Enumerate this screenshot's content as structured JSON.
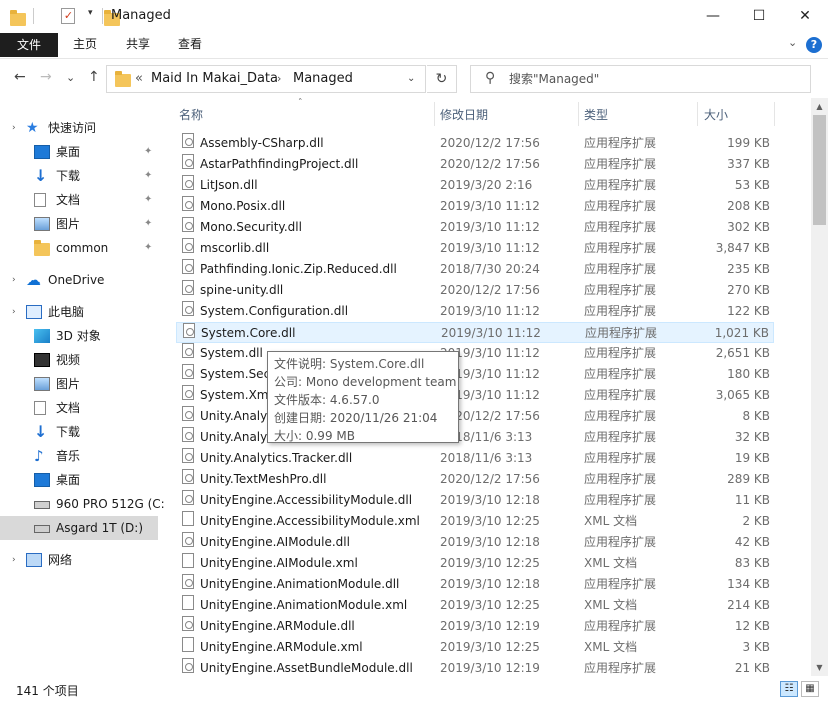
{
  "titlebar": {
    "title": "Managed",
    "dropdown_glyph": "▾",
    "minimize_glyph": "—",
    "maximize_glyph": "☐",
    "close_glyph": "✕"
  },
  "ribbon": {
    "tabs": [
      "文件",
      "主页",
      "共享",
      "查看"
    ],
    "expand_glyph": "⌄",
    "help_glyph": "?"
  },
  "address": {
    "back_glyph": "←",
    "forward_glyph": "→",
    "recent_glyph": "⌄",
    "up_glyph": "↑",
    "overflow": "«",
    "crumbs": [
      "Maid In Makai_Data",
      "Managed"
    ],
    "separator": "›",
    "dropdown_glyph": "⌄",
    "refresh_glyph": "↻",
    "search_glyph": "⚲",
    "search_placeholder": "搜索\"Managed\""
  },
  "sidebar": {
    "items": [
      {
        "label": "快速访问",
        "icon": "star-icon"
      },
      {
        "label": "桌面",
        "icon": "desktop-icon",
        "pinned": true
      },
      {
        "label": "下载",
        "icon": "download-icon",
        "pinned": true
      },
      {
        "label": "文档",
        "icon": "document-icon",
        "pinned": true
      },
      {
        "label": "图片",
        "icon": "pictures-icon",
        "pinned": true
      },
      {
        "label": "common",
        "icon": "folder-icon",
        "pinned": true
      },
      {
        "label": "OneDrive",
        "icon": "cloud-icon"
      },
      {
        "label": "此电脑",
        "icon": "pc-icon"
      },
      {
        "label": "3D 对象",
        "icon": "cube-icon"
      },
      {
        "label": "视频",
        "icon": "video-icon"
      },
      {
        "label": "图片",
        "icon": "pictures-icon"
      },
      {
        "label": "文档",
        "icon": "document-icon"
      },
      {
        "label": "下载",
        "icon": "download-icon"
      },
      {
        "label": "音乐",
        "icon": "music-icon"
      },
      {
        "label": "桌面",
        "icon": "desktop-icon"
      },
      {
        "label": "960 PRO 512G (C:",
        "icon": "drive-icon"
      },
      {
        "label": "Asgard 1T (D:)",
        "icon": "drive-icon",
        "selected": true
      },
      {
        "label": "网络",
        "icon": "network-icon"
      }
    ],
    "pin_glyph": "✦",
    "expand_glyph": "›"
  },
  "columns": {
    "name": "名称",
    "date": "修改日期",
    "type": "类型",
    "size": "大小",
    "sort_glyph": "˄"
  },
  "files": [
    {
      "name": "Assembly-CSharp.dll",
      "date": "2020/12/2 17:56",
      "type": "应用程序扩展",
      "size": "199 KB",
      "kind": "dll"
    },
    {
      "name": "AstarPathfindingProject.dll",
      "date": "2020/12/2 17:56",
      "type": "应用程序扩展",
      "size": "337 KB",
      "kind": "dll"
    },
    {
      "name": "LitJson.dll",
      "date": "2019/3/20 2:16",
      "type": "应用程序扩展",
      "size": "53 KB",
      "kind": "dll"
    },
    {
      "name": "Mono.Posix.dll",
      "date": "2019/3/10 11:12",
      "type": "应用程序扩展",
      "size": "208 KB",
      "kind": "dll"
    },
    {
      "name": "Mono.Security.dll",
      "date": "2019/3/10 11:12",
      "type": "应用程序扩展",
      "size": "302 KB",
      "kind": "dll"
    },
    {
      "name": "mscorlib.dll",
      "date": "2019/3/10 11:12",
      "type": "应用程序扩展",
      "size": "3,847 KB",
      "kind": "dll"
    },
    {
      "name": "Pathfinding.Ionic.Zip.Reduced.dll",
      "date": "2018/7/30 20:24",
      "type": "应用程序扩展",
      "size": "235 KB",
      "kind": "dll"
    },
    {
      "name": "spine-unity.dll",
      "date": "2020/12/2 17:56",
      "type": "应用程序扩展",
      "size": "270 KB",
      "kind": "dll"
    },
    {
      "name": "System.Configuration.dll",
      "date": "2019/3/10 11:12",
      "type": "应用程序扩展",
      "size": "122 KB",
      "kind": "dll"
    },
    {
      "name": "System.Core.dll",
      "date": "2019/3/10 11:12",
      "type": "应用程序扩展",
      "size": "1,021 KB",
      "kind": "dll",
      "hover": true
    },
    {
      "name": "System.dll",
      "date": "2019/3/10 11:12",
      "type": "应用程序扩展",
      "size": "2,651 KB",
      "kind": "dll"
    },
    {
      "name": "System.Secu",
      "date": "2019/3/10 11:12",
      "type": "应用程序扩展",
      "size": "180 KB",
      "kind": "dll"
    },
    {
      "name": "System.Xml.",
      "date": "2019/3/10 11:12",
      "type": "应用程序扩展",
      "size": "3,065 KB",
      "kind": "dll"
    },
    {
      "name": "Unity.Analyt",
      "date": "2020/12/2 17:56",
      "type": "应用程序扩展",
      "size": "8 KB",
      "kind": "dll"
    },
    {
      "name": "Unity.Analyt",
      "date": "2018/11/6 3:13",
      "type": "应用程序扩展",
      "size": "32 KB",
      "kind": "dll"
    },
    {
      "name": "Unity.Analytics.Tracker.dll",
      "date": "2018/11/6 3:13",
      "type": "应用程序扩展",
      "size": "19 KB",
      "kind": "dll"
    },
    {
      "name": "Unity.TextMeshPro.dll",
      "date": "2020/12/2 17:56",
      "type": "应用程序扩展",
      "size": "289 KB",
      "kind": "dll"
    },
    {
      "name": "UnityEngine.AccessibilityModule.dll",
      "date": "2019/3/10 12:18",
      "type": "应用程序扩展",
      "size": "11 KB",
      "kind": "dll"
    },
    {
      "name": "UnityEngine.AccessibilityModule.xml",
      "date": "2019/3/10 12:25",
      "type": "XML 文档",
      "size": "2 KB",
      "kind": "xml"
    },
    {
      "name": "UnityEngine.AIModule.dll",
      "date": "2019/3/10 12:18",
      "type": "应用程序扩展",
      "size": "42 KB",
      "kind": "dll"
    },
    {
      "name": "UnityEngine.AIModule.xml",
      "date": "2019/3/10 12:25",
      "type": "XML 文档",
      "size": "83 KB",
      "kind": "xml"
    },
    {
      "name": "UnityEngine.AnimationModule.dll",
      "date": "2019/3/10 12:18",
      "type": "应用程序扩展",
      "size": "134 KB",
      "kind": "dll"
    },
    {
      "name": "UnityEngine.AnimationModule.xml",
      "date": "2019/3/10 12:25",
      "type": "XML 文档",
      "size": "214 KB",
      "kind": "xml"
    },
    {
      "name": "UnityEngine.ARModule.dll",
      "date": "2019/3/10 12:19",
      "type": "应用程序扩展",
      "size": "12 KB",
      "kind": "dll"
    },
    {
      "name": "UnityEngine.ARModule.xml",
      "date": "2019/3/10 12:25",
      "type": "XML 文档",
      "size": "3 KB",
      "kind": "xml"
    },
    {
      "name": "UnityEngine.AssetBundleModule.dll",
      "date": "2019/3/10 12:19",
      "type": "应用程序扩展",
      "size": "21 KB",
      "kind": "dll"
    }
  ],
  "tooltip": {
    "lines": [
      "文件说明: System.Core.dll",
      "公司: Mono development team",
      "文件版本: 4.6.57.0",
      "创建日期: 2020/11/26 21:04",
      "大小: 0.99 MB"
    ]
  },
  "scrollbar": {
    "up_glyph": "▲",
    "down_glyph": "▼"
  },
  "status": {
    "count": "141 个项目",
    "details_view_glyph": "☷",
    "icons_view_glyph": "▦"
  }
}
